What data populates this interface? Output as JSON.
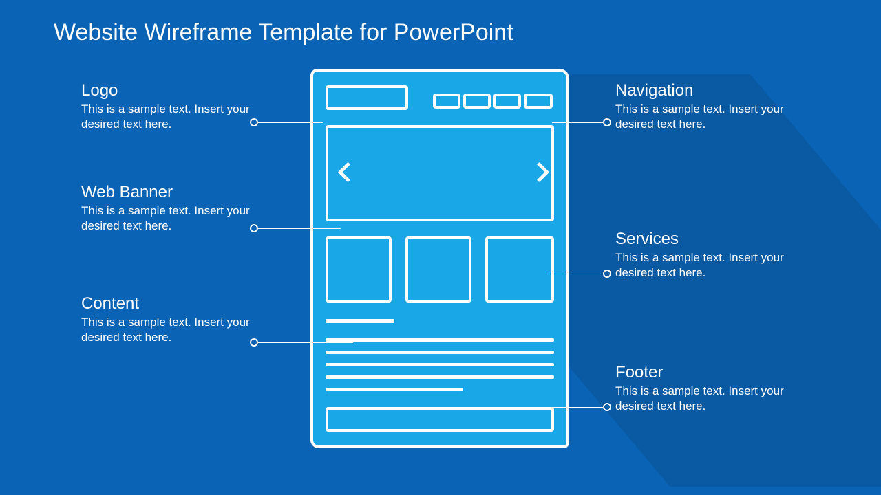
{
  "slide": {
    "title": "Website Wireframe Template for PowerPoint"
  },
  "callouts": {
    "logo": {
      "heading": "Logo",
      "body": "This is a sample text. Insert your desired text here."
    },
    "banner": {
      "heading": "Web Banner",
      "body": "This is a sample text. Insert your desired text here."
    },
    "content": {
      "heading": "Content",
      "body": "This is a sample text. Insert your desired text here."
    },
    "nav": {
      "heading": "Navigation",
      "body": "This is a sample text. Insert your desired text here."
    },
    "services": {
      "heading": "Services",
      "body": "This is a sample text. Insert your desired text here."
    },
    "footer": {
      "heading": "Footer",
      "body": "This is a sample text. Insert your desired text here."
    }
  },
  "colors": {
    "background": "#0a63b4",
    "wireframe_fill": "#1aa7e8",
    "stroke": "#ffffff",
    "shadow": "#0959a3"
  }
}
